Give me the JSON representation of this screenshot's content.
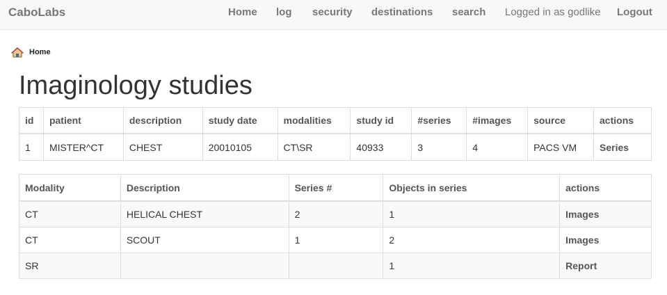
{
  "navbar": {
    "brand": "CaboLabs",
    "items": [
      {
        "label": "Home"
      },
      {
        "label": "log"
      },
      {
        "label": "security"
      },
      {
        "label": "destinations"
      },
      {
        "label": "search"
      }
    ],
    "logged_in_text": "Logged in as godlike",
    "logout_label": "Logout"
  },
  "breadcrumb": {
    "home_label": "Home",
    "icon": "home-icon"
  },
  "page": {
    "title": "Imaginology studies"
  },
  "studies_table": {
    "headers": [
      "id",
      "patient",
      "description",
      "study date",
      "modalities",
      "study id",
      "#series",
      "#images",
      "source",
      "actions"
    ],
    "rows": [
      {
        "id": "1",
        "patient": "MISTER^CT",
        "description": "CHEST",
        "study_date": "20010105",
        "modalities": "CT\\SR",
        "study_id": "40933",
        "series": "3",
        "images": "4",
        "source": "PACS VM",
        "action": "Series"
      }
    ]
  },
  "series_table": {
    "headers": [
      "Modality",
      "Description",
      "Series #",
      "Objects in series",
      "actions"
    ],
    "rows": [
      {
        "modality": "CT",
        "description": "HELICAL CHEST",
        "series_number": "2",
        "objects": "1",
        "action": "Images"
      },
      {
        "modality": "CT",
        "description": "SCOUT",
        "series_number": "1",
        "objects": "2",
        "action": "Images"
      },
      {
        "modality": "SR",
        "description": "",
        "series_number": "",
        "objects": "1",
        "action": "Report"
      }
    ]
  },
  "colors": {
    "navbar_bg": "#f8f8f8",
    "link": "#777777",
    "border": "#dddddd",
    "stripe": "#f9f9f9"
  }
}
